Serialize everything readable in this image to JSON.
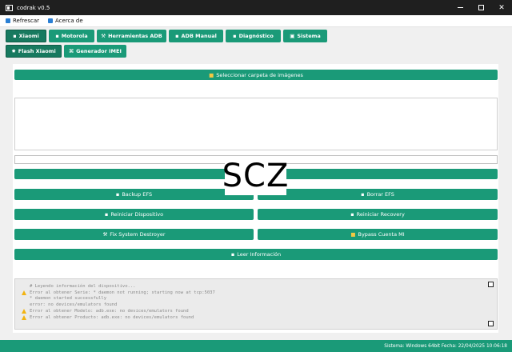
{
  "window": {
    "title": "codrak v0.5"
  },
  "menu": [
    {
      "label": "Refrescar",
      "icon": "refresh-icon"
    },
    {
      "label": "Acerca de",
      "icon": "info-icon"
    }
  ],
  "tabs_main": [
    {
      "label": "Xiaomi",
      "icon": "xiaomi-icon"
    },
    {
      "label": "Motorola",
      "icon": "motorola-icon"
    },
    {
      "label": "Herramientas ADB",
      "icon": "tools-icon"
    },
    {
      "label": "ADB Manual",
      "icon": "manual-icon"
    },
    {
      "label": "Diagnóstico",
      "icon": "diagnostic-icon"
    },
    {
      "label": "Sistema",
      "icon": "system-icon"
    }
  ],
  "tabs_sub": [
    {
      "label": "Flash Xiaomi",
      "icon": "flash-icon"
    },
    {
      "label": "Generador IMEI",
      "icon": "imei-icon"
    }
  ],
  "actions": {
    "select_folder": "Seleccionar carpeta de imágenes",
    "backup_efs": "Backup EFS",
    "borrar_efs": "Borrar EFS",
    "reiniciar_dispositivo": "Reiniciar Dispositivo",
    "reiniciar_recovery": "Reiniciar Recovery",
    "fix_system": "Fix System Destroyer",
    "bypass_mi": "Bypass Cuenta MI",
    "leer_info": "Leer Información"
  },
  "watermark": "SCZ",
  "log": [
    {
      "level": "info",
      "text": "# Leyendo información del dispositivo..."
    },
    {
      "level": "warn",
      "text": "Error al obtener Serie: * daemon not running; starting now at tcp:5037"
    },
    {
      "level": "info",
      "text": "* daemon started successfully"
    },
    {
      "level": "info",
      "text": "error: no devices/emulators found"
    },
    {
      "level": "warn",
      "text": "Error al obtener Modelo: adb.exe: no devices/emulators found"
    },
    {
      "level": "warn",
      "text": "Error al obtener Producto: adb.exe: no devices/emulators found"
    }
  ],
  "status": {
    "text": "Sistema: Windows 64bit  Fecha: 22/04/2025 10:06:18"
  }
}
